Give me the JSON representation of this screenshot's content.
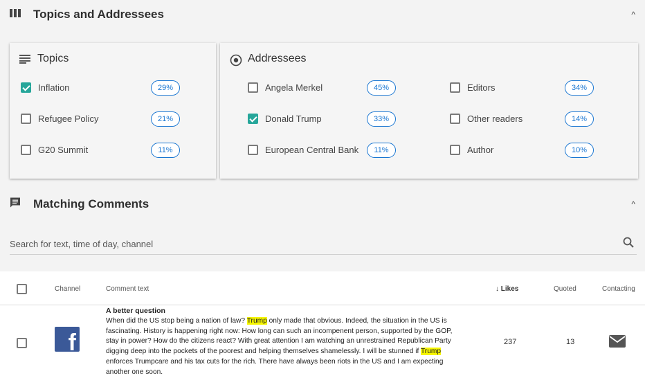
{
  "topics_section": {
    "title": "Topics and Addressees",
    "collapse_glyph": "^",
    "topics": {
      "title": "Topics",
      "icon": "list-icon",
      "items": [
        {
          "label": "Inflation",
          "pct": "29%",
          "checked": true
        },
        {
          "label": "Refugee Policy",
          "pct": "21%",
          "checked": false
        },
        {
          "label": "G20 Summit",
          "pct": "11%",
          "checked": false
        }
      ]
    },
    "addressees": {
      "title": "Addressees",
      "icon": "radio-target-icon",
      "col1": [
        {
          "label": "Angela Merkel",
          "pct": "45%",
          "checked": false
        },
        {
          "label": "Donald Trump",
          "pct": "33%",
          "checked": true
        },
        {
          "label": "European Central Bank",
          "pct": "11%",
          "checked": false
        }
      ],
      "col2": [
        {
          "label": "Editors",
          "pct": "34%",
          "checked": false
        },
        {
          "label": "Other readers",
          "pct": "14%",
          "checked": false
        },
        {
          "label": "Author",
          "pct": "10%",
          "checked": false
        }
      ]
    }
  },
  "comments_section": {
    "title": "Matching Comments",
    "collapse_glyph": "^",
    "search": {
      "placeholder": "Search for text, time of day, channel",
      "value": ""
    },
    "columns": {
      "channel": "Channel",
      "comment": "Comment text",
      "likes": "↓ Likes",
      "quoted": "Quoted",
      "contacting": "Contacting"
    },
    "rows": [
      {
        "channel": "facebook",
        "channel_glyph": "f",
        "title": "A better question",
        "parts": {
          "p1": "When did the US stop being a nation of law? ",
          "h1": "Trump",
          "p2": " only made that obvious. Indeed, the situation in the US is fascinating. History is happening right now: How long can such an incompenent person, supported by the GOP, stay in power? How do the citizens react? With great attention I am watching an unrestrained Republican Party digging deep into the pockets of the poorest and helping themselves shamelessly. I will be stunned if ",
          "h2": "Trump",
          "p3": " enforces Trumpcare and his tax cuts for the rich. There have always been riots in the US and I am expecting another one soon."
        },
        "likes": "237",
        "quoted": "13",
        "contacting": "mail-icon"
      }
    ]
  },
  "colors": {
    "accent_blue": "#1976d2",
    "check_teal": "#26a69a",
    "facebook": "#3b5998",
    "highlight": "#f5f500"
  }
}
